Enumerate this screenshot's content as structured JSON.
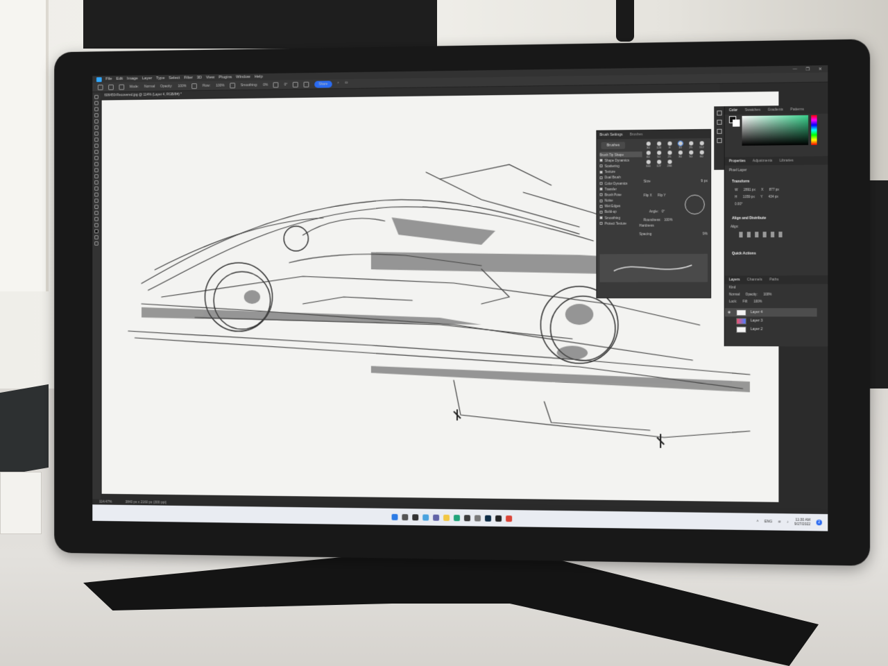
{
  "menu": [
    "File",
    "Edit",
    "Image",
    "Layer",
    "Type",
    "Select",
    "Filter",
    "3D",
    "View",
    "Plugins",
    "Window",
    "Help"
  ],
  "options": {
    "mode_label": "Mode:",
    "mode_value": "Normal",
    "opacity_label": "Opacity:",
    "opacity_value": "100%",
    "flow_label": "Flow:",
    "flow_value": "100%",
    "smoothing_label": "Smoothing:",
    "smoothing_value": "0%",
    "angle_value": "0°",
    "share_label": "Share"
  },
  "document_tab": "606459-Recovered.jpg @ 114% (Layer 4, RGB/8#) *",
  "status": {
    "zoom": "114.47%",
    "size": "3840 px x 2160 px (300 ppi)"
  },
  "brush_panel": {
    "tab_settings": "Brush Settings",
    "tab_brushes": "Brushes",
    "brushes_button": "Brushes",
    "items": [
      {
        "label": "Brush Tip Shape",
        "checked": false
      },
      {
        "label": "Shape Dynamics",
        "checked": true
      },
      {
        "label": "Scattering",
        "checked": false
      },
      {
        "label": "Texture",
        "checked": true
      },
      {
        "label": "Dual Brush",
        "checked": false
      },
      {
        "label": "Color Dynamics",
        "checked": false
      },
      {
        "label": "Transfer",
        "checked": true
      },
      {
        "label": "Brush Pose",
        "checked": false
      },
      {
        "label": "Noise",
        "checked": false
      },
      {
        "label": "Wet Edges",
        "checked": false
      },
      {
        "label": "Build-up",
        "checked": false
      },
      {
        "label": "Smoothing",
        "checked": true
      },
      {
        "label": "Protect Texture",
        "checked": false
      }
    ],
    "tip_sizes": [
      "30",
      "123",
      "8",
      "10",
      "25",
      "112",
      "60",
      "50",
      "25",
      "30",
      "50",
      "60",
      "100",
      "127",
      "284"
    ],
    "size_label": "Size",
    "size_value": "9 px",
    "flip_x": "Flip X",
    "flip_y": "Flip Y",
    "angle_label": "Angle:",
    "angle_value": "0°",
    "roundness_label": "Roundness:",
    "roundness_value": "100%",
    "hardness_label": "Hardness",
    "spacing_label": "Spacing",
    "spacing_value": "9%"
  },
  "color_panel": {
    "tabs": [
      "Color",
      "Swatches",
      "Gradients",
      "Patterns"
    ]
  },
  "properties_panel": {
    "tabs": [
      "Properties",
      "Adjustments",
      "Libraries"
    ],
    "pixel_layer": "Pixel Layer",
    "transform_title": "Transform",
    "w_label": "W",
    "w_value": "2891 px",
    "x_label": "X",
    "x_value": "877 px",
    "h_label": "H",
    "h_value": "1059 px",
    "y_label": "Y",
    "y_value": "434 px",
    "angle_value": "0.00°",
    "align_title": "Align and Distribute",
    "align_label": "Align:",
    "quick_actions": "Quick Actions"
  },
  "layers_panel": {
    "tabs": [
      "Layers",
      "Channels",
      "Paths"
    ],
    "kind_label": "Kind",
    "blend_mode": "Normal",
    "opacity_label": "Opacity:",
    "opacity_value": "100%",
    "lock_label": "Lock:",
    "fill_label": "Fill:",
    "fill_value": "100%",
    "layers": [
      {
        "name": "Layer 4",
        "selected": true
      },
      {
        "name": "Layer 3",
        "selected": false
      },
      {
        "name": "Layer 2",
        "selected": false
      }
    ]
  },
  "tray": {
    "lang": "ENG",
    "time": "11:30 AM",
    "date": "9/27/2022",
    "notifications": "2"
  },
  "colors": {
    "ps_blue": "#31a8ff",
    "share_blue": "#2a6bf1",
    "panel_bg": "#3a3a3a",
    "canvas": "#f3f3f1"
  },
  "icons": {
    "taskbar": [
      "windows-start-icon",
      "search-icon",
      "task-view-icon",
      "widgets-icon",
      "chat-icon",
      "file-explorer-icon",
      "edge-icon",
      "store-icon",
      "mail-icon",
      "photoshop-icon",
      "app-icon",
      "chrome-icon"
    ]
  }
}
